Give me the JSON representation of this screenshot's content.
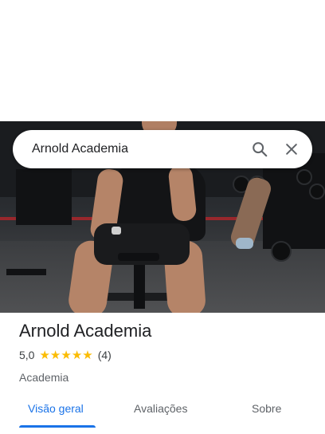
{
  "search": {
    "query": "Arnold Academia",
    "search_icon": "search-icon",
    "close_icon": "close-icon"
  },
  "place": {
    "name": "Arnold Academia",
    "rating": "5,0",
    "stars": 5,
    "review_count": "(4)",
    "category": "Academia"
  },
  "tabs": [
    {
      "label": "Visão geral",
      "active": true
    },
    {
      "label": "Avaliações",
      "active": false
    },
    {
      "label": "Sobre",
      "active": false
    }
  ],
  "colors": {
    "accent": "#1a73e8",
    "star": "#fbbc04",
    "text": "#202124",
    "secondary": "#5f6368"
  }
}
